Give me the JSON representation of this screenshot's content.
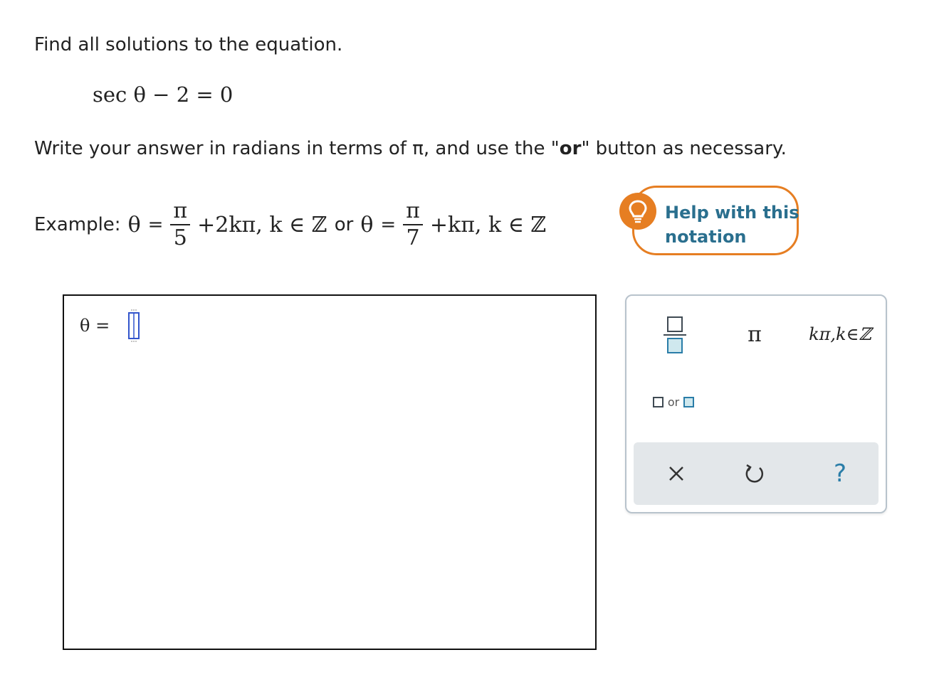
{
  "prompt": {
    "instruction": "Find all solutions to the equation.",
    "equation": "sec θ − 2 = 0",
    "directions_prefix": "Write your answer in radians in terms of π, and use the \"",
    "directions_bold": "or",
    "directions_suffix": "\" button as necessary."
  },
  "example": {
    "label": "Example:",
    "theta": "θ",
    "equals": "=",
    "frac1_num": "π",
    "frac1_den": "5",
    "term1": "+2kπ, k ∈ ℤ",
    "or_text": "or",
    "frac2_num": "π",
    "frac2_den": "7",
    "term2": "+kπ, k ∈ ℤ"
  },
  "help": {
    "label": "Help with this notation"
  },
  "answer": {
    "label": "θ =",
    "value": ""
  },
  "palette": {
    "pi_label": "π",
    "kpi_label": "kπ,k∈ℤ",
    "or_label": "or",
    "help_label": "?"
  },
  "colors": {
    "accent_orange": "#e67e22",
    "link_blue": "#2a6f8e",
    "palette_border": "#b8c3cc",
    "palette_bottom_bg": "#e3e7ea"
  }
}
